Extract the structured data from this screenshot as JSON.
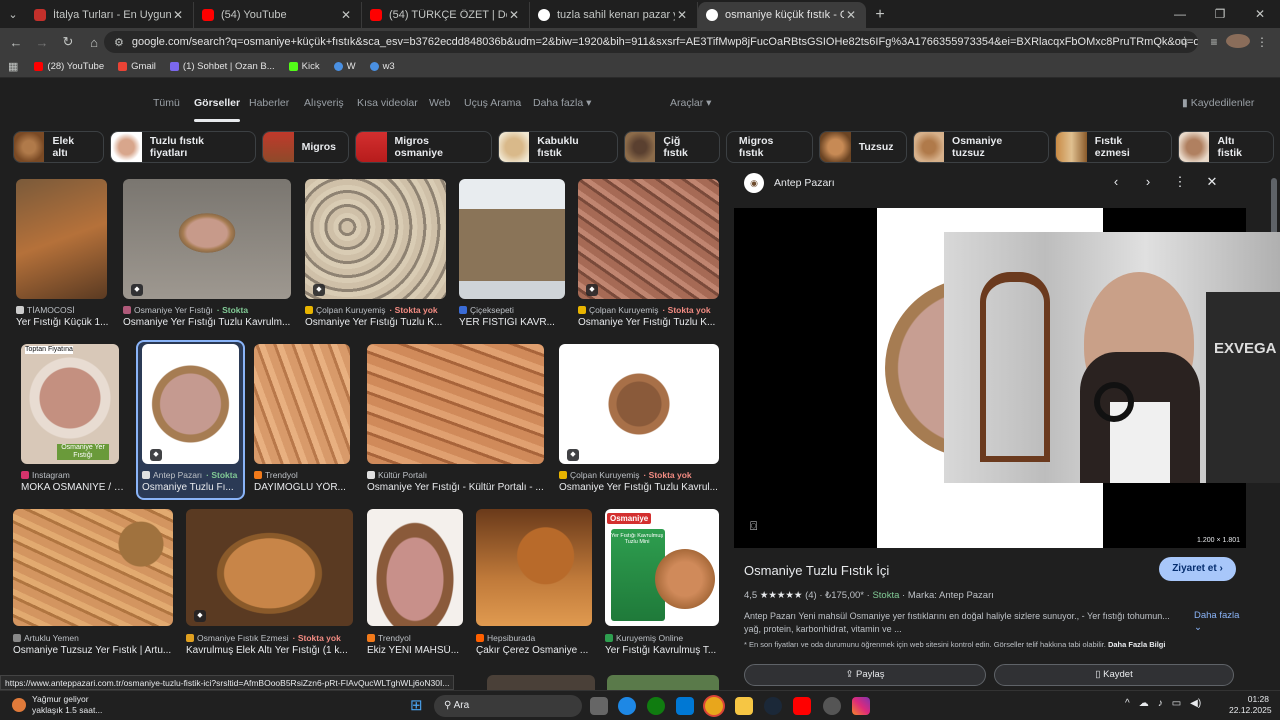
{
  "tabs": [
    {
      "title": "İtalya Turları - En Uygun İtalya T",
      "color": "#c4302b"
    },
    {
      "title": "(54) YouTube",
      "color": "#ff0000"
    },
    {
      "title": "(54) TÜRKÇE ÖZET | Denver Nu",
      "color": "#ff0000"
    },
    {
      "title": "tuzla sahil kenarı pazar yeri - G",
      "color": "#ffffff"
    },
    {
      "title": "osmaniye küçük fıstık - Google",
      "color": "#ffffff"
    }
  ],
  "address": "google.com/search?q=osmaniye+küçük+fıstık&sca_esv=b3762ecdd848036b&udm=2&biw=1920&bih=911&sxsrf=AE3TifMwp8jFucOaRBtsGSIOHe82ts6IFg%3A1766355973354&ei=BXRlacqxFbOMxc8PruTRmQk&oq=osmaniye+küçük+fı&gs_lp=Egtnd...",
  "bookmarks": [
    {
      "label": "(28) YouTube",
      "color": "#ff0000"
    },
    {
      "label": "Gmail",
      "color": "#ea4335"
    },
    {
      "label": "(1) Sohbet | Ozan B...",
      "color": "#7b68ee"
    },
    {
      "label": "Kick",
      "color": "#53fc18"
    },
    {
      "label": "W",
      "color": "#4a90e2"
    },
    {
      "label": "w3",
      "color": "#4a90e2"
    }
  ],
  "navtabs": [
    "Tümü",
    "Görseller",
    "Haberler",
    "Alışveriş",
    "Kısa videolar",
    "Web",
    "Uçuş Arama",
    "Daha fazla ▾",
    "Araçlar ▾"
  ],
  "saved_label": "Kaydedilenler",
  "chips": [
    "Elek altı",
    "Tuzlu fıstık fiyatları",
    "Migros",
    "Migros osmaniye",
    "Kabuklu fıstık",
    "Çiğ fıstık",
    "Migros fıstık",
    "Tuzsuz",
    "Osmaniye tuzsuz",
    "Fıstık ezmesi",
    "Altı fistik"
  ],
  "results": [
    {
      "source": "TİAMOCOSİ",
      "stock": "",
      "caption": "Yer Fıstığı Küçük 1...",
      "icon": "#cccccc"
    },
    {
      "source": "Osmaniye Yer Fıstığı",
      "stock": "· Stokta",
      "caption": "Osmaniye Yer Fıstığı Tuzlu Kavrulm...",
      "icon": "#b05a7a"
    },
    {
      "source": "Çolpan Kuruyemiş",
      "stock": "· Stokta yok",
      "caption": "Osmaniye Yer Fıstığı Tuzlu K...",
      "icon": "#e8b400"
    },
    {
      "source": "Çiçeksepeti",
      "stock": "",
      "caption": "YER FISTIĞI KAVR...",
      "icon": "#3a6bd6"
    },
    {
      "source": "Çolpan Kuruyemiş",
      "stock": "· Stokta yok",
      "caption": "Osmaniye Yer Fıstığı Tuzlu K...",
      "icon": "#e8b400"
    },
    {
      "source": "Instagram",
      "stock": "",
      "caption": "MOKA OSMANİYE / K...",
      "icon": "#d6336c"
    },
    {
      "source": "Antep Pazarı",
      "stock": "· Stokta",
      "caption": "Osmaniye Tuzlu Fı...",
      "icon": "#e0e0e0"
    },
    {
      "source": "Trendyol",
      "stock": "",
      "caption": "DAYIMOĞLU YÖR...",
      "icon": "#f27a1a"
    },
    {
      "source": "Kültür Portalı",
      "stock": "",
      "caption": "Osmaniye Yer Fıstığı - Kültür Portalı - ...",
      "icon": "#e0e0e0"
    },
    {
      "source": "Çolpan Kuruyemiş",
      "stock": "· Stokta yok",
      "caption": "Osmaniye Yer Fıstığı Tuzlu Kavrul...",
      "icon": "#e8b400"
    },
    {
      "source": "Artuklu Yemen",
      "stock": "",
      "caption": "Osmaniye Tuzsuz Yer Fıstık | Artu...",
      "icon": "#888888"
    },
    {
      "source": "Osmaniye Fıstık Ezmesi",
      "stock": "· Stokta yok",
      "caption": "Kavrulmuş Elek Altı Yer Fıstığı (1 k...",
      "icon": "#e0a020"
    },
    {
      "source": "Trendyol",
      "stock": "",
      "caption": "Ekiz YENİ MAHSÜ...",
      "icon": "#f27a1a"
    },
    {
      "source": "Hepsiburada",
      "stock": "",
      "caption": "Çakır Çerez Osmaniye ...",
      "icon": "#ff6000"
    },
    {
      "source": "Kuruyemiş Online",
      "stock": "",
      "caption": "Yer Fıstığı Kavrulmuş T...",
      "icon": "#2e9e4f"
    }
  ],
  "overlay_texts": {
    "instagram_top": "Toptan Fiyatına",
    "instagram_bottom": "Osmaniye Yer Fıstığı",
    "osmaniye_brand": "Osmaniye",
    "osmaniye_bag": "Yer Fıstığı Kavrulmuş Tuzlu Mini",
    "webcam_brand": "EXVEGA"
  },
  "preview": {
    "site": "Antep Pazarı",
    "dimensions": "1.200 × 1.801",
    "title": "Osmaniye Tuzlu Fıstık İçi",
    "visit": "Ziyaret et  ›",
    "rating": "4,5",
    "stars": "★★★★★",
    "reviews": "(4)",
    "price": "₺175,00*",
    "stock": "Stokta",
    "brand": "Marka: Antep Pazarı",
    "desc": "Antep Pazarı Yeni mahsül Osmaniye yer fıstıklarını en doğal haliyle sizlere sunuyor., - Yer fıstığı tohumun... yağ, protein, karbonhidrat, vitamin ve ...",
    "more": "Daha fazla",
    "note": "* En son fiyatları ve oda durumunu öğrenmek için web sitesini kontrol edin. Görseller telif hakkına tabi olabilir.",
    "note_link": "Daha Fazla Bilgi",
    "share": "Paylaş",
    "save": "Kaydet"
  },
  "status_url": "https://www.anteppazari.com.tr/osmaniye-tuzlu-fistik-ici?srsltid=AfmBOooB5RsiZzn6-pRt-FIAvQucWLTghWLj6oN30I...",
  "taskbar": {
    "weather_title": "Yağmur geliyor",
    "weather_sub": "yaklaşık 1.5 saat...",
    "search": "Ara",
    "time": "01:28",
    "date": "22.12.2025"
  }
}
